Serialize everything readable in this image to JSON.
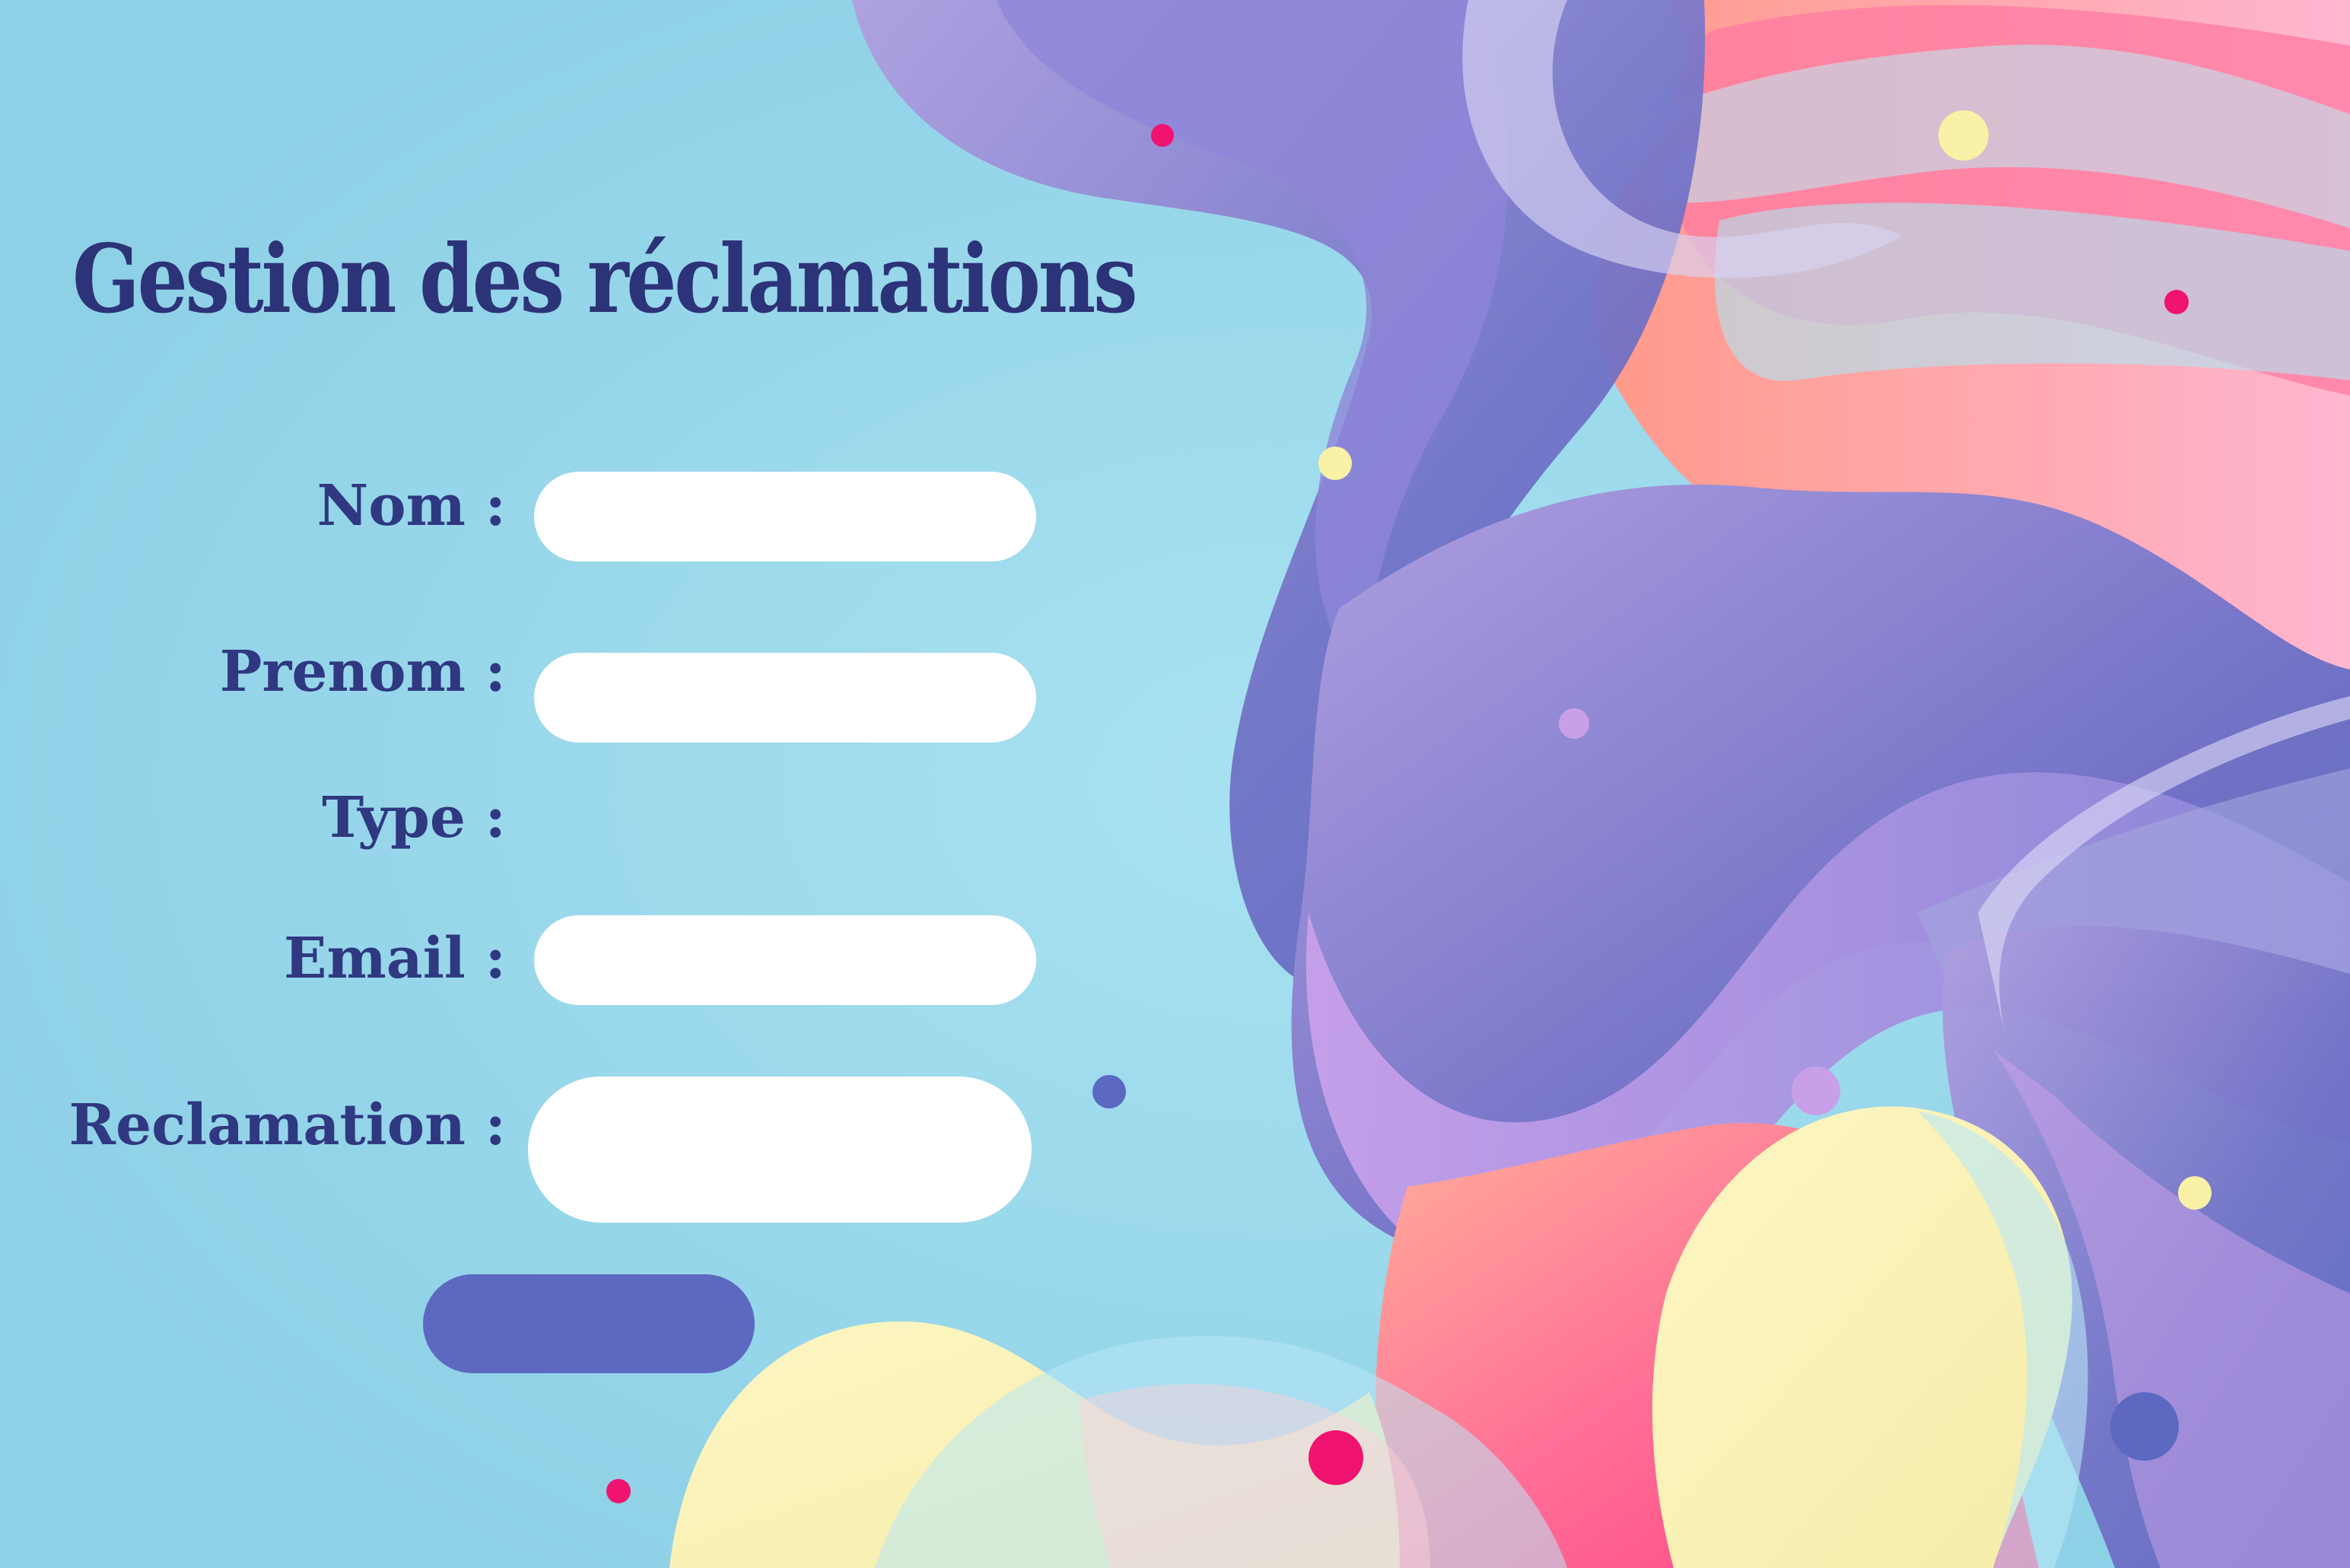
{
  "page": {
    "title": "Gestion des réclamations"
  },
  "form": {
    "nom_label": "Nom :",
    "prenom_label": "Prenom :",
    "type_label": "Type :",
    "email_label": "Email :",
    "reclamation_label": "Reclamation :",
    "nom_value": "",
    "prenom_value": "",
    "email_value": "",
    "reclamation_value": "",
    "submit_label": ""
  },
  "colors": {
    "background": "#93d3e9",
    "title": "#2c3378",
    "label": "#2f3880",
    "field": "#ffffff",
    "button": "#5d68c0",
    "purple_blob": "#8a86d8",
    "pink_blob": "#ff5c8e",
    "yellow_blob": "#fbf3b8"
  }
}
